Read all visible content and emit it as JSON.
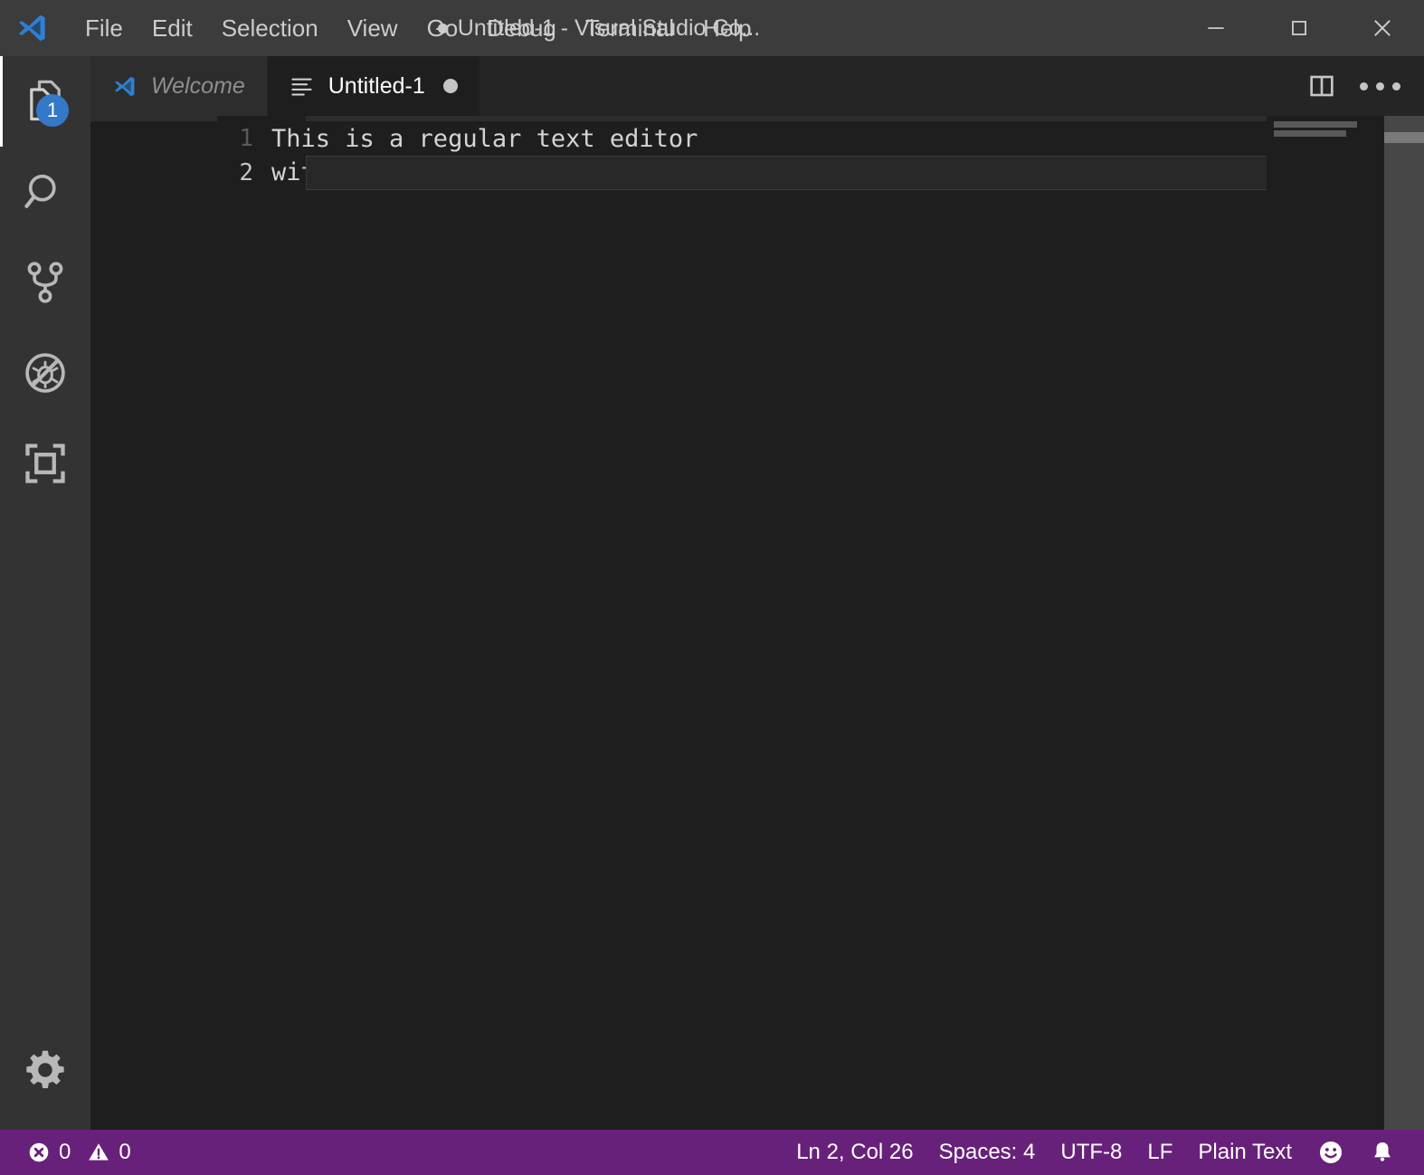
{
  "window": {
    "title": "Untitled-1 - Visual Studio Co...",
    "dirty": true,
    "logo_name": "vscode-logo",
    "controls": {
      "minimize_label": "—",
      "maximize_label": "☐",
      "close_label": "✕"
    }
  },
  "menubar": {
    "items": [
      {
        "label": "File"
      },
      {
        "label": "Edit"
      },
      {
        "label": "Selection"
      },
      {
        "label": "View"
      },
      {
        "label": "Go"
      },
      {
        "label": "Debug"
      },
      {
        "label": "Terminal"
      },
      {
        "label": "Help"
      }
    ]
  },
  "activitybar": {
    "items": [
      {
        "name": "explorer",
        "icon": "files-icon",
        "badge": "1"
      },
      {
        "name": "search",
        "icon": "search-icon",
        "badge": ""
      },
      {
        "name": "source-control",
        "icon": "source-control-icon",
        "badge": ""
      },
      {
        "name": "run-and-debug",
        "icon": "debug-alt-icon",
        "badge": ""
      },
      {
        "name": "extensions",
        "icon": "extensions-icon",
        "badge": ""
      }
    ],
    "bottom": [
      {
        "name": "manage",
        "icon": "gear-icon"
      }
    ],
    "badge_color": "#3478c8"
  },
  "tabs": [
    {
      "label": "Welcome",
      "icon": "vscode-logo-icon",
      "active": false,
      "dirty": false
    },
    {
      "label": "Untitled-1",
      "icon": "list-icon",
      "active": true,
      "dirty": true
    }
  ],
  "editor_actions": [
    {
      "name": "split-editor",
      "icon": "split-editor-icon"
    },
    {
      "name": "more-actions",
      "icon": "ellipsis-icon"
    }
  ],
  "editor": {
    "lines": [
      {
        "number": "1",
        "text": "This is a regular text editor",
        "current": false
      },
      {
        "number": "2",
        "text": "with some extra features.",
        "current": true
      }
    ],
    "minimap": {
      "line1": "This is a regular text editor",
      "line2": "with some extra features."
    }
  },
  "statusbar": {
    "errors_icon": "error-icon",
    "errors": "0",
    "warnings_icon": "warning-icon",
    "warnings": "0",
    "cursor_position": "Ln 2, Col 26",
    "indentation": "Spaces: 4",
    "encoding": "UTF-8",
    "eol": "LF",
    "language": "Plain Text",
    "feedback_icon": "smiley-icon",
    "notifications_icon": "bell-icon",
    "background": "#68217a"
  }
}
